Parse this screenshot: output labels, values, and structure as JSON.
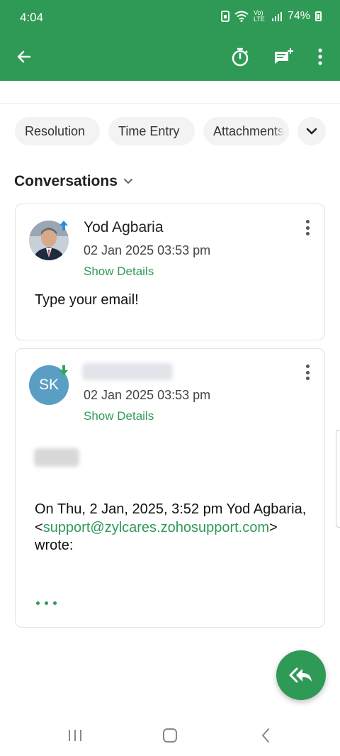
{
  "status_bar": {
    "time": "4:04",
    "network_label": "Vo) LTE",
    "battery": "74%"
  },
  "app_bar": {
    "back_icon": "arrow-left-icon",
    "timer_icon": "stopwatch-icon",
    "add_comment_icon": "comment-add-icon",
    "more_icon": "more-vertical-icon"
  },
  "tabs": [
    {
      "label": "Resolution"
    },
    {
      "label": "Time Entry"
    },
    {
      "label": "Attachments"
    }
  ],
  "conversations": {
    "label": "Conversations",
    "items": [
      {
        "sender": "Yod Agbaria",
        "date": "02 Jan 2025 03:53 pm",
        "show_details": "Show Details",
        "body": "Type your email!",
        "direction": "outgoing"
      },
      {
        "sender": "",
        "initials": "SK",
        "date": "02 Jan 2025 03:53 pm",
        "show_details": "Show Details",
        "quote_prefix": "On Thu, 2 Jan, 2025, 3:52 pm Yod Agbaria,",
        "quote_email": "support@zylcares.zohosupport.com",
        "quote_suffix": "wrote:",
        "direction": "incoming"
      }
    ]
  },
  "fab": {
    "icon": "reply-all-icon"
  },
  "nav_bar": {
    "recents_icon": "recents-icon",
    "home_icon": "home-icon",
    "back_icon": "nav-back-icon"
  },
  "colors": {
    "primary": "#2f9a56",
    "avatar_sk": "#5a9ec4",
    "incoming_badge": "#2ea84f",
    "outgoing_badge": "#2a8fd6"
  }
}
